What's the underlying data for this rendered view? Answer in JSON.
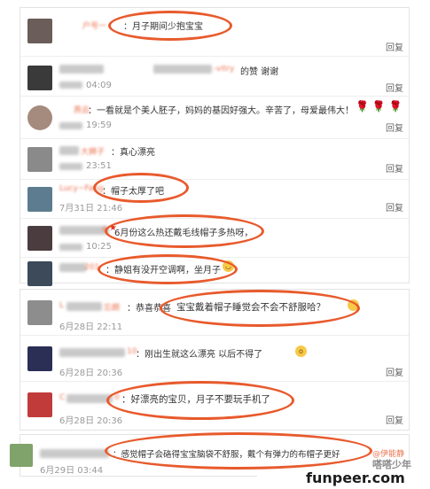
{
  "panel1": {
    "comments": [
      {
        "name": "户号一",
        "text": "：月子期间少抱宝宝",
        "date": "",
        "reply": "回复"
      },
      {
        "name": "-vitry",
        "text": "的赞 谢谢",
        "date": "04:09",
        "reply": "回复"
      },
      {
        "name": "燕云",
        "text": "：一看就是个美人胚子，妈妈的基因好强大。辛苦了，母爱最伟大！",
        "date": "19:59",
        "reply": "回复"
      },
      {
        "name": "大狮子",
        "text": "：真心漂亮",
        "date": "23:51",
        "reply": "回复"
      },
      {
        "name": "Lucy~Fang",
        "text": "：帽子太厚了吧",
        "date": "7月31日 21:46",
        "reply": "回复"
      },
      {
        "name": "a",
        "text": "6月份这么热还戴毛线帽子多热呀，",
        "date": "10:25",
        "reply": "回复"
      },
      {
        "name": "201",
        "text": "：静姐有没开空调啊，坐月子",
        "date": "",
        "reply": ""
      }
    ]
  },
  "panel2": {
    "comments": [
      {
        "name": "L",
        "name2": "忘朗",
        "text": "：恭喜恭喜",
        "text2": "宝宝戴着帽子睡觉会不会不舒服哈？",
        "date": "6月28日 22:11",
        "reply": ""
      },
      {
        "name": "10",
        "text": "：刚出生就这么漂亮 以后不得了",
        "date": "6月28日 20:36",
        "reply": "回复"
      },
      {
        "name": "C",
        "name2": "0",
        "text": "：好漂亮的宝贝，月子不要玩手机了",
        "date": "6月28日 20:36",
        "reply": "回复"
      }
    ]
  },
  "panel3": {
    "comment": {
      "name": "",
      "text": "：感觉帽子会硌得宝宝脑袋不舒服，戴个有弹力的布帽子更好",
      "mention": "@伊能静",
      "date": "6月29日 03:44"
    }
  },
  "watermark": {
    "site": "funpeer.com",
    "tag": "嗒嗒少年"
  },
  "colors": {
    "highlight": "#e85a2c",
    "username": "#eb7350",
    "reply": "#666666",
    "date": "#999999"
  }
}
